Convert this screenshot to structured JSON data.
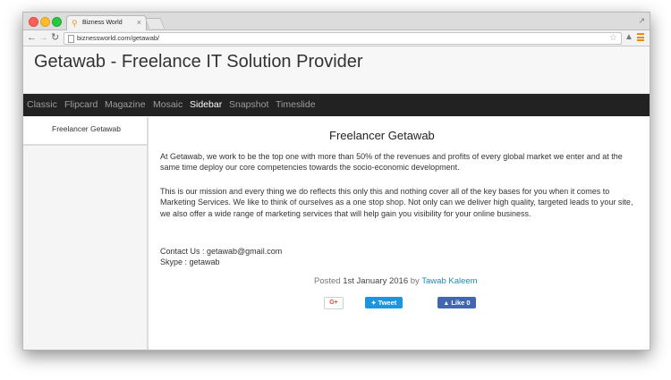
{
  "browser": {
    "tab_title": "Bizness World",
    "tab_favicon": "pin-icon",
    "url": "biznessworld.com/getawab/",
    "icons": [
      "back-icon",
      "forward-icon",
      "reload-icon",
      "bookmark-star-icon",
      "extension-icon",
      "menu-icon",
      "close-icon",
      "resize-icon"
    ]
  },
  "site": {
    "title": "Getawab - Freelance IT Solution Provider"
  },
  "nav": {
    "items": [
      {
        "label": "Classic"
      },
      {
        "label": "Flipcard"
      },
      {
        "label": "Magazine"
      },
      {
        "label": "Mosaic"
      },
      {
        "label": "Sidebar"
      },
      {
        "label": "Snapshot"
      },
      {
        "label": "Timeslide"
      }
    ],
    "active": "Sidebar"
  },
  "sidebar": {
    "items": [
      {
        "label": "Freelancer Getawab"
      }
    ]
  },
  "post": {
    "title": "Freelancer Getawab",
    "paragraph1": "At Getawab, we work to be the top one with more than 50% of the revenues and profits of every global market we enter and at the same time deploy our core competencies towards the socio-economic development.",
    "paragraph2": "This is our mission and every thing we do reflects this only this and nothing  cover all of the key bases for you when it comes to Marketing Services. We like to think of ourselves as a one stop shop. Not only can we deliver high quality, targeted leads to your site, we also offer a wide range of marketing services that will help gain you visibility for your online business.",
    "contact_line": "Contact Us : getawab@gmail.com",
    "skype_line": "Skype : getawab",
    "posted_label": "Posted",
    "date": "1st January 2016",
    "by_label": "by",
    "author": "Tawab Kaleem"
  },
  "share": {
    "gplus_label": "G+",
    "tweet_label": "Tweet",
    "like_label": "Like 0"
  },
  "colors": {
    "navbar": "#222222",
    "nav_active": "#ffffff",
    "nav_inactive": "#9d9d9d",
    "author_link": "#1a8fb3",
    "tweet": "#1b95e0",
    "like": "#4267b2",
    "gplus": "#dd4b39"
  }
}
